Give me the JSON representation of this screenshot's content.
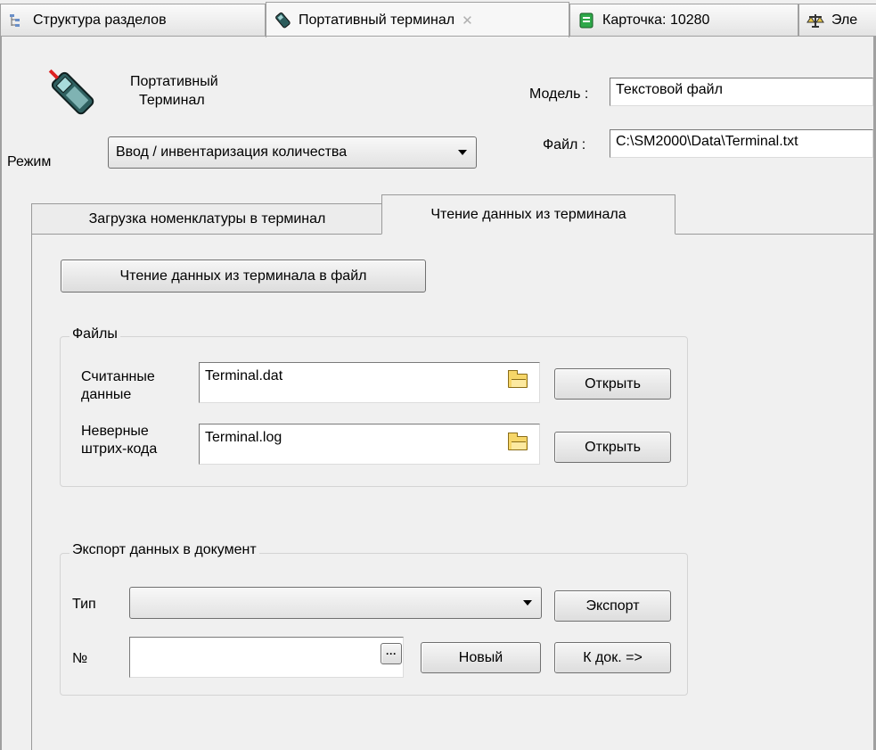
{
  "doc_tabs": [
    {
      "label": "Структура разделов",
      "icon": "tree-icon"
    },
    {
      "label": "Портативный терминал",
      "icon": "terminal-icon",
      "closable": true
    },
    {
      "label": "Карточка: 10280",
      "icon": "card-icon"
    },
    {
      "label": "Эле",
      "icon": "scales-icon"
    }
  ],
  "header": {
    "title_line1": "Портативный",
    "title_line2": "Терминал",
    "model_label": "Модель :",
    "model_value": "Текстовой файл",
    "file_label": "Файл :",
    "file_value": "C:\\SM2000\\Data\\Terminal.txt",
    "mode_label": "Режим",
    "mode_value": "Ввод / инвентаризация количества"
  },
  "tabs": [
    {
      "label": "Загрузка номенклатуры в терминал",
      "active": false
    },
    {
      "label": "Чтение данных из терминала",
      "active": true
    }
  ],
  "read_button": "Чтение данных из терминала в файл",
  "files_group": {
    "title": "Файлы",
    "read_label_1": "Считанные",
    "read_label_2": "данные",
    "read_value": "Terminal.dat",
    "bad_label_1": "Неверные",
    "bad_label_2": "штрих-кода",
    "bad_value": "Terminal.log",
    "open_label": "Открыть"
  },
  "export_group": {
    "title": "Экспорт данных в документ",
    "type_label": "Тип",
    "type_value": "",
    "export_button": "Экспорт",
    "number_label": "№",
    "number_value": "",
    "ellipsis": "···",
    "new_button": "Новый",
    "to_doc_button": "К док. =>"
  },
  "colors": {
    "background": "#f0f0f0",
    "tab_active": "#ffffff",
    "folder": "#f6d669"
  }
}
